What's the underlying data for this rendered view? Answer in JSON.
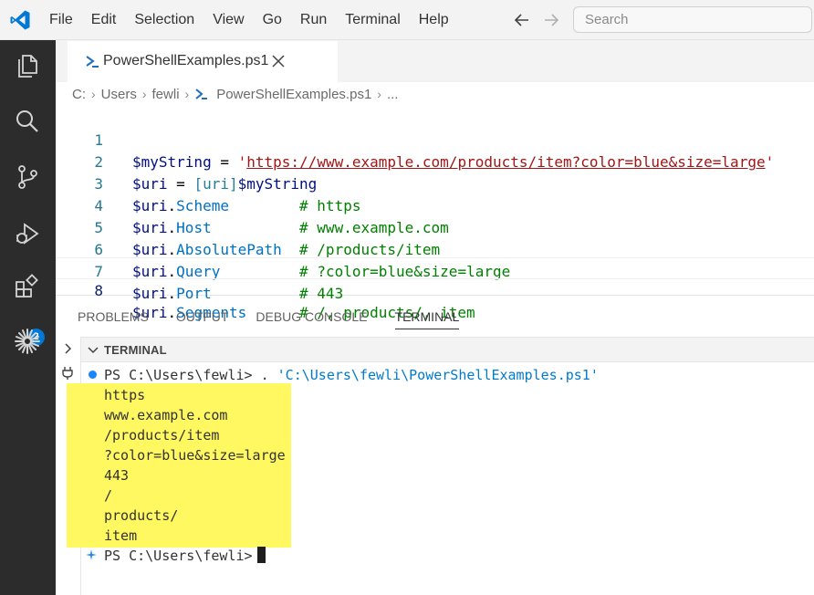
{
  "menu": [
    "File",
    "Edit",
    "Selection",
    "View",
    "Go",
    "Run",
    "Terminal",
    "Help"
  ],
  "search": {
    "placeholder": "Search"
  },
  "activity": {
    "extensions_badge": "2"
  },
  "tab": {
    "label": "PowerShellExamples.ps1"
  },
  "breadcrumbs": [
    "C:",
    "Users",
    "fewli",
    "PowerShellExamples.ps1",
    "..."
  ],
  "editor": {
    "line_numbers": [
      "1",
      "2",
      "3",
      "4",
      "5",
      "6",
      "7",
      "8"
    ],
    "lines": [
      {
        "var": "$myString",
        "op": " = ",
        "str_open": "'",
        "url": "https://www.example.com/products/item?color=blue&size=large",
        "str_close": "'"
      },
      {
        "var": "$uri",
        "op": " = ",
        "type": "[uri]",
        "var2": "$myString"
      },
      {
        "var": "$uri",
        "dot": ".",
        "prop": "Scheme",
        "pad": "        ",
        "comment": "# https"
      },
      {
        "var": "$uri",
        "dot": ".",
        "prop": "Host",
        "pad": "          ",
        "comment": "# www.example.com"
      },
      {
        "var": "$uri",
        "dot": ".",
        "prop": "AbsolutePath",
        "pad": "  ",
        "comment": "# /products/item"
      },
      {
        "var": "$uri",
        "dot": ".",
        "prop": "Query",
        "pad": "         ",
        "comment": "# ?color=blue&size=large"
      },
      {
        "var": "$uri",
        "dot": ".",
        "prop": "Port",
        "pad": "          ",
        "comment": "# 443"
      },
      {
        "var": "$uri",
        "dot": ".",
        "prop": "Segments",
        "pad": "      ",
        "comment": "# /, products/, item"
      }
    ]
  },
  "panel": {
    "tabs": [
      "PROBLEMS",
      "OUTPUT",
      "DEBUG CONSOLE",
      "TERMINAL"
    ],
    "active_tab": "TERMINAL",
    "terminal_title": "TERMINAL"
  },
  "terminal": {
    "prompt": "PS C:\\Users\\fewli> ",
    "command_prefix": ". ",
    "command_path": "'C:\\Users\\fewli\\PowerShellExamples.ps1'",
    "output": [
      "https",
      "www.example.com",
      "/products/item",
      "?color=blue&size=large",
      "443",
      "/",
      "products/",
      "item"
    ],
    "final_prompt": "PS C:\\Users\\fewli>"
  },
  "colors": {
    "accent": "#0078d4",
    "highlight": "#fff860",
    "comment": "#008000",
    "string": "#a31515"
  }
}
